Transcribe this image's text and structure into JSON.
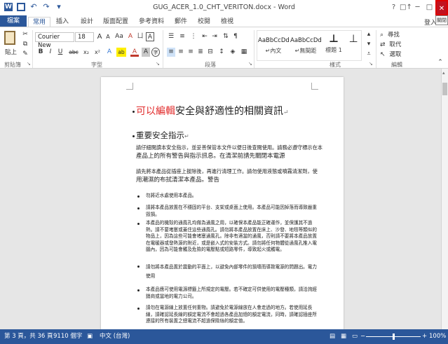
{
  "titlebar": {
    "title": "GUG_ACER_1.0_CHT_VERITON.docx - Word",
    "help": "?",
    "ribbon_display": "□↑",
    "minimize": "─",
    "maximize": "□",
    "close": "✕",
    "tooltip": "關閉",
    "quick_access": [
      "word-icon",
      "save-icon",
      "undo-icon",
      "redo-icon",
      "customize-icon"
    ]
  },
  "tabs": {
    "file": "檔案",
    "items": [
      "常用",
      "插入",
      "設計",
      "版面配置",
      "參考資料",
      "郵件",
      "校閱",
      "檢視"
    ],
    "signin": "登入"
  },
  "ribbon": {
    "clipboard": {
      "paste": "貼上",
      "label": "剪貼簿"
    },
    "font": {
      "name": "Courier New",
      "size": "18",
      "grow": "A",
      "shrink": "A",
      "change_case": "Aa",
      "clear_format": "A",
      "phonetic": "ㄩ",
      "enclose": "A",
      "bold": "B",
      "italic": "I",
      "underline": "U",
      "strike": "abc",
      "subscript": "x₂",
      "superscript": "x²",
      "text_effects": "A",
      "highlight": "ab",
      "font_color": "A",
      "char_shading": "A",
      "enclosed": "字",
      "label": "字型"
    },
    "paragraph": {
      "label": "段落"
    },
    "styles": {
      "items": [
        {
          "sample": "AaBbCcDd",
          "name": "↵內文"
        },
        {
          "sample": "AaBbCcDd",
          "name": "↵無間距"
        },
        {
          "sample": "⊥",
          "name": "標題 1"
        },
        {
          "sample": "⊥",
          "name": ""
        }
      ],
      "label": "樣式"
    },
    "editing": {
      "find": "尋找",
      "replace": "取代",
      "select": "選取",
      "label": "編輯"
    }
  },
  "document": {
    "title_red": "可以編輯",
    "title_rest": "安全與舒適性的相關資訊",
    "heading": "重要安全指示",
    "para1_line1": "請仔細閱讀本安全指示，並妥善保管本文件以便日後查閱使用。請務必遵守標示在本",
    "para1_line2": "產品上的所有警告與指示訊息。在清潔前請先關閉本電源",
    "para2_line1": "請先將本產品從插座上拔除後，再進行清理工作。請勿使用液態或噴霧清潔劑，使",
    "para2_line2": "用潮濕的布拭清潔本產品。警告",
    "list": [
      "勿將近水處使用本產品。",
      "請將本產品放置在不穩固的平台、支架或桌面上使用。本產品可能因掉落而導致嚴重毀損。",
      "本產品的機殼的通風孔均做為通風之用，以確保本產品能正確運作，並保護其不過熱。請不要堵塞或蓋住這些通風孔。請勿將本產品放置在床上、沙發、地毯等類似的物品上，因為這些可能會堵塞通風孔。除非有適當的通風，否則請不要將本產品放置在電暖器或發熱源的附近，或是嵌入式的安裝方式。請勿將任何物體從通風孔推入電腦內，因為可能會觸及危險的電壓點或短路零件，導致起火或觸電。",
      "請勿將本產品置於震動的平面上，以避免內部零件的損壞而導致電源的問題出。電力使用",
      "本產品應可使用電源標籤上所規定的電壓。若不確定可供使用的電壓種類，請洽詢經銷商或當地的電力公司。",
      "請勿在電源線上放置任何重物。請避免於電源線放在人會走過的地方。若使用延長線，請確認延長線的額定電流不會超過各產品加總的額定電流，同時，請確認插座所連接的所有裝置之總電流不超過保險絲的額定值。"
    ]
  },
  "status": {
    "page": "第 3 頁，共 36 頁",
    "words": "9110 個字",
    "proof_icon": "proofing-icon",
    "language": "中文 (台灣)",
    "zoom": "100%",
    "zoom_out": "−",
    "zoom_in": "+"
  }
}
